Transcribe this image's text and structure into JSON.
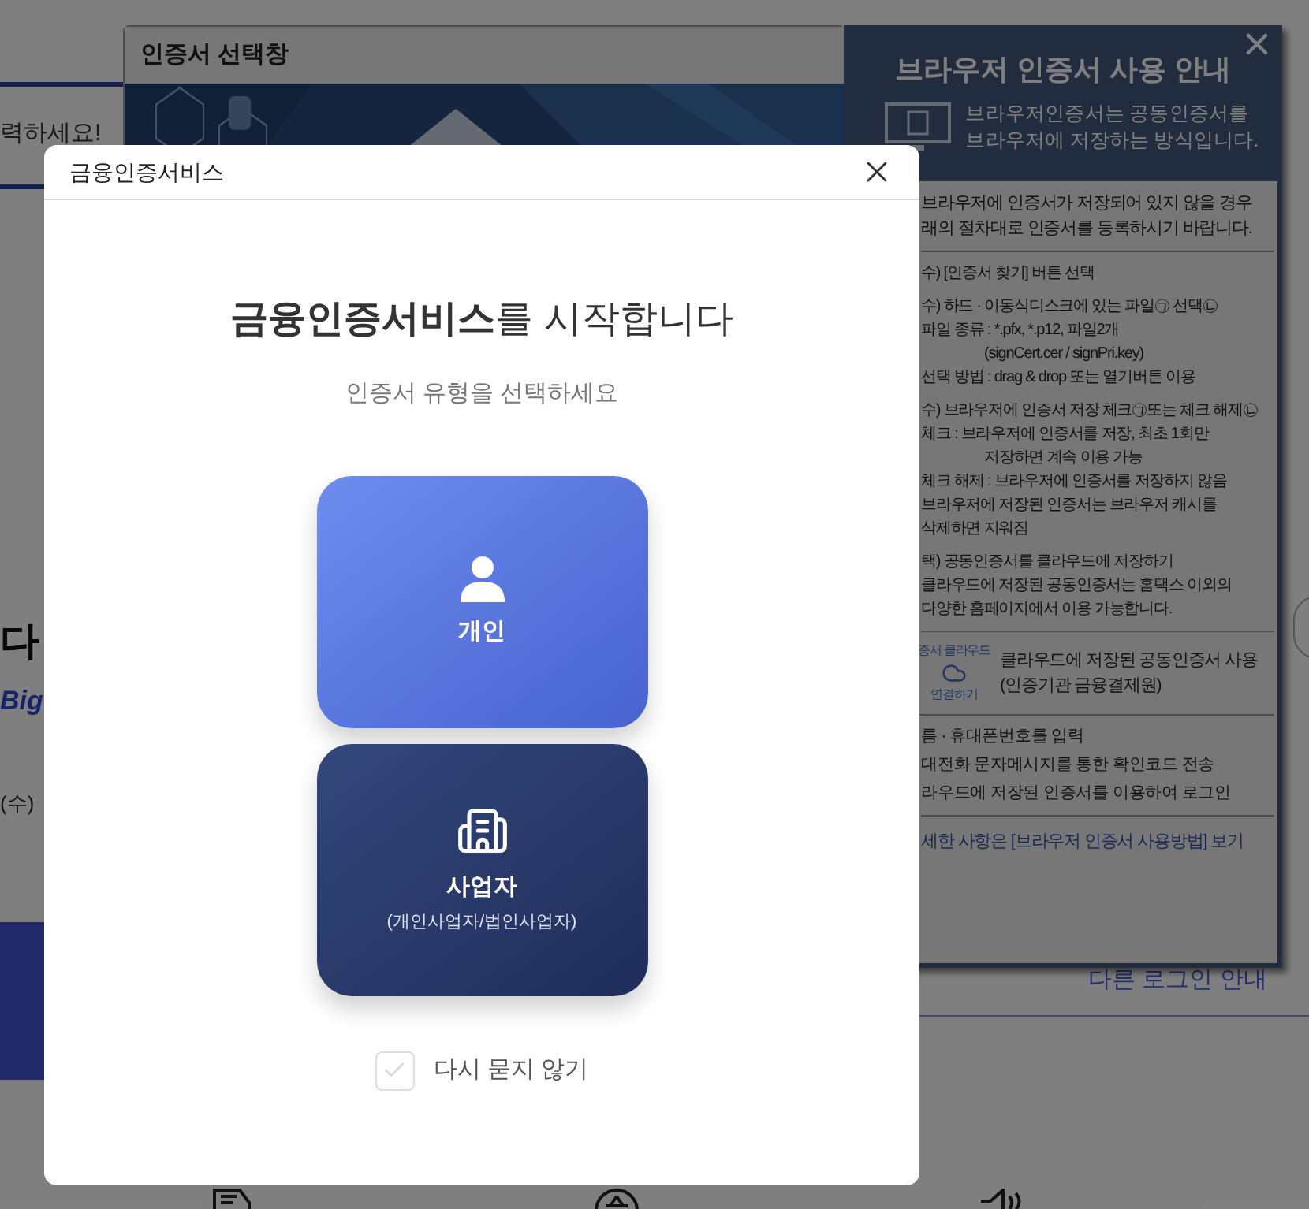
{
  "background_page": {
    "prompt_fragment": "력하세요!",
    "headline_fragment": "다",
    "english_fragment": "Big",
    "date_fragment": "(수)",
    "other_login_link": "다른 로그인 안내"
  },
  "certificate_window": {
    "title": "인증서 선택창"
  },
  "browser_guide": {
    "title": "브라우저 인증서 사용 안내",
    "intro_lines": [
      "브라우저인증서는 공동인증서를",
      "브라우저에 저장하는 방식입니다."
    ],
    "notice_lines": [
      "브라우저에 인증서가 저장되어 있지 않을 경우",
      "래의 절차대로 인증서를 등록하시기 바랍니다."
    ],
    "step_groups": [
      {
        "lines": [
          {
            "kind": "main",
            "text": "수) [인증서 찾기] 버튼 선택"
          }
        ]
      },
      {
        "lines": [
          {
            "kind": "main",
            "text": "수) 하드 · 이동식디스크에 있는 파일㉠ 선택㉡"
          },
          {
            "kind": "main",
            "text": "파일 종류 : *.pfx,  *.p12, 파일2개"
          },
          {
            "kind": "indent",
            "text": "(signCert.cer / signPri.key)"
          },
          {
            "kind": "main",
            "text": "선택 방법 : drag & drop 또는 열기버튼 이용"
          }
        ]
      },
      {
        "lines": [
          {
            "kind": "main",
            "text": "수) 브라우저에 인증서 저장 체크㉠또는 체크 해제㉡"
          },
          {
            "kind": "main",
            "text": "체크 : 브라우저에 인증서를 저장, 최초 1회만"
          },
          {
            "kind": "indent",
            "text": "저장하면 계속 이용 가능"
          },
          {
            "kind": "main",
            "text": "체크 해제 : 브라우저에 인증서를 저장하지 않음"
          },
          {
            "kind": "main",
            "text": "브라우저에 저장된 인증서는 브라우저 캐시를"
          },
          {
            "kind": "main",
            "text": "삭제하면 지워짐"
          }
        ]
      },
      {
        "lines": [
          {
            "kind": "main",
            "text": "택) 공동인증서를 클라우드에 저장하기"
          },
          {
            "kind": "main",
            "text": "클라우드에 저장된 공동인증서는 홈택스 이외의"
          },
          {
            "kind": "main",
            "text": "다양한 홈페이지에서 이용 가능합니다."
          }
        ]
      }
    ],
    "cloud": {
      "badge_top": "증서 클라우드",
      "badge_bottom": "연결하기",
      "lines": [
        "클라우드에 저장된 공동인증서 사용",
        "(인증기관 금융결제원)"
      ]
    },
    "cloud_steps": [
      "름 · 휴대폰번호를 입력",
      "대전화 문자메시지를 통한 확인코드 전송",
      "라우드에 저장된 인증서를 이용하여 로그인"
    ],
    "link": "세한 사항은 [브라우저 인증서 사용방법] 보기"
  },
  "modal": {
    "title": "금융인증서비스",
    "heading": "**금융인증서비스**를 시작합니다",
    "subtitle": "인증서 유형을 선택하세요",
    "options": [
      {
        "kind": "personal",
        "label": "개인"
      },
      {
        "kind": "business",
        "label": "사업자",
        "sublabel": "(개인사업자/법인사업자)"
      }
    ],
    "dont_ask": {
      "label": "다시 묻지 않기",
      "checked": false
    }
  }
}
